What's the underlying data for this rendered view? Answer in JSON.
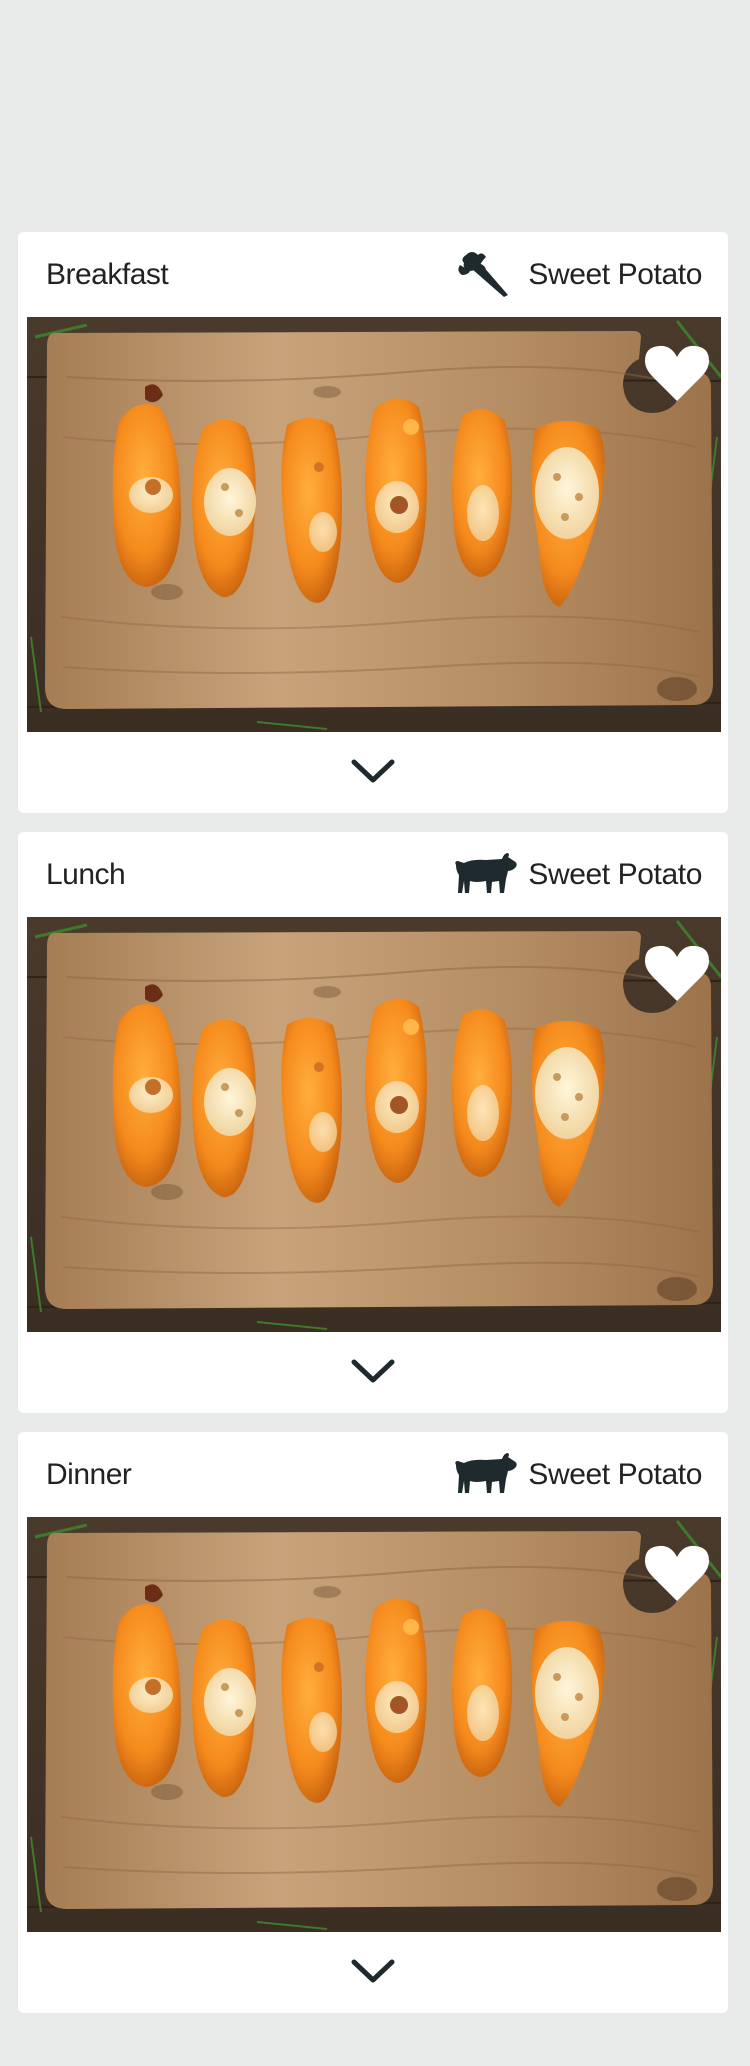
{
  "cards": [
    {
      "meal": "Breakfast",
      "food": "Sweet Potato",
      "food_icon": "carrot-icon"
    },
    {
      "meal": "Lunch",
      "food": "Sweet Potato",
      "food_icon": "cow-icon"
    },
    {
      "meal": "Dinner",
      "food": "Sweet Potato",
      "food_icon": "cow-icon"
    }
  ],
  "photo_subject": "baked-sweet-potatoes-on-cutting-board",
  "colors": {
    "background": "#e9eaea",
    "card": "#ffffff",
    "text": "#222222",
    "icon": "#1f2a2e",
    "favorite": "#ffffff"
  }
}
